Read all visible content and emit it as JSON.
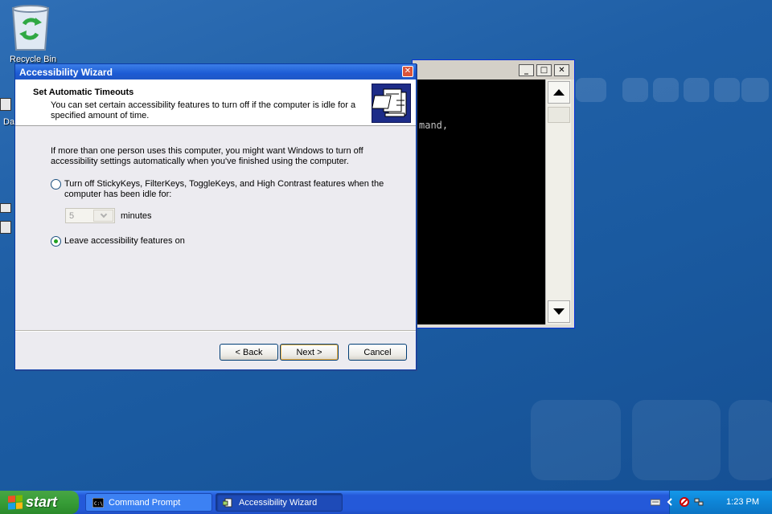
{
  "desktop": {
    "recycle_bin_label": "Recycle Bin",
    "edge_text_1": "Da"
  },
  "console_window": {
    "visible_text": "mand,",
    "buttons": {
      "minimize": "_",
      "maximize": "□",
      "close": "✕"
    }
  },
  "dialog": {
    "title": "Accessibility Wizard",
    "header_title": "Set Automatic Timeouts",
    "header_subtitle": "You can set certain accessibility features to turn off if the computer is idle for a specified amount of time.",
    "intro": "If more than one person uses this computer, you might want Windows to turn off accessibility settings automatically when you've finished using the computer.",
    "option_turn_off": "Turn off StickyKeys, FilterKeys, ToggleKeys, and High Contrast features when the computer has been idle for:",
    "option_turn_off_selected": false,
    "minutes_value": "5",
    "minutes_label": "minutes",
    "option_leave_on": "Leave accessibility features on",
    "option_leave_on_selected": true,
    "back_label": "< Back",
    "next_label": "Next >",
    "cancel_label": "Cancel"
  },
  "taskbar": {
    "start_label": "start",
    "tasks": [
      {
        "label": "Command Prompt",
        "icon": "console-icon",
        "active": false
      },
      {
        "label": "Accessibility Wizard",
        "icon": "accessibility-icon",
        "active": true
      }
    ],
    "clock": "1:23 PM"
  },
  "colors": {
    "titlebar": "#1c5bd4",
    "taskbar": "#2459d9",
    "start_button": "#379d37",
    "tray": "#0e84d6"
  }
}
